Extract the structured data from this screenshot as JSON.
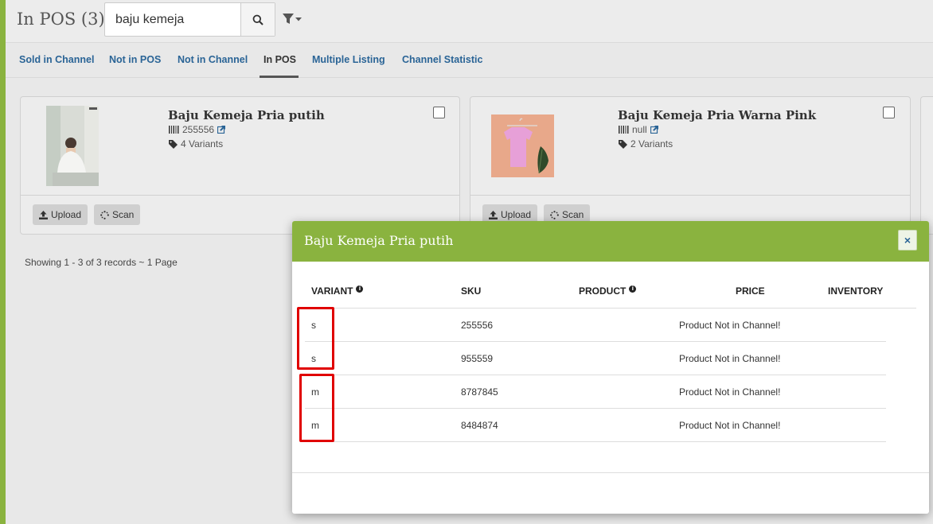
{
  "header": {
    "title": "In POS (3)",
    "search": {
      "value": "baju kemeja",
      "placeholder": ""
    },
    "search_icon": "search-icon",
    "filter_icon": "filter-icon"
  },
  "tabs": [
    {
      "label": "Sold in Channel",
      "active": false
    },
    {
      "label": "Not in POS",
      "active": false
    },
    {
      "label": "Not in Channel",
      "active": false
    },
    {
      "label": "In POS",
      "active": true
    },
    {
      "label": "Multiple Listing",
      "active": false
    },
    {
      "label": "Channel Statistic",
      "active": false
    }
  ],
  "products": [
    {
      "name": "Baju Kemeja Pria putih",
      "sku": "255556",
      "variants": "4 Variants",
      "upload_label": "Upload",
      "scan_label": "Scan"
    },
    {
      "name": "Baju Kemeja Pria Warna Pink",
      "sku": "null",
      "variants": "2 Variants",
      "upload_label": "Upload",
      "scan_label": "Scan"
    }
  ],
  "records_text": "Showing 1 - 3 of 3 records ~ 1 Page",
  "modal": {
    "title": "Baju Kemeja Pria putih",
    "close_label": "×",
    "columns": {
      "variant": "VARIANT",
      "sku": "SKU",
      "product": "PRODUCT",
      "price": "PRICE",
      "inventory": "INVENTORY"
    },
    "rows": [
      {
        "variant": "s",
        "sku": "255556",
        "status": "Product Not in Channel!"
      },
      {
        "variant": "s",
        "sku": "955559",
        "status": "Product Not in Channel!"
      },
      {
        "variant": "m",
        "sku": "8787845",
        "status": "Product Not in Channel!"
      },
      {
        "variant": "m",
        "sku": "8484874",
        "status": "Product Not in Channel!"
      }
    ]
  },
  "colors": {
    "accent": "#8ab33f",
    "link": "#2a6496",
    "highlight": "#e00000"
  }
}
